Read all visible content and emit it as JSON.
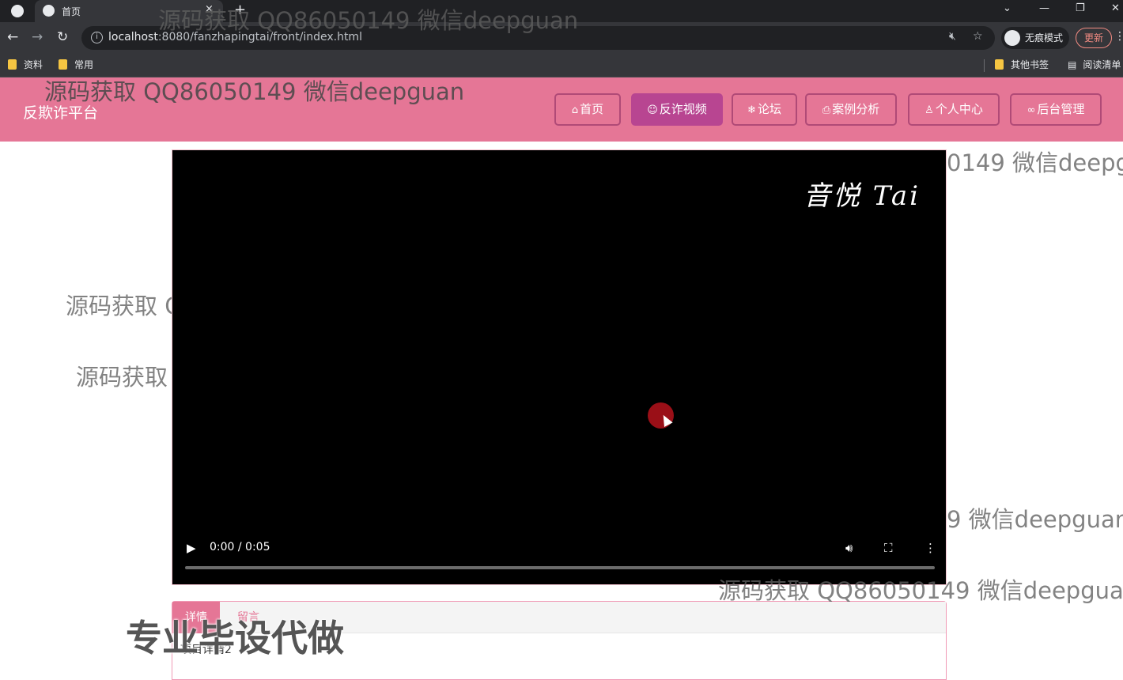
{
  "browser": {
    "tab_title": "首页",
    "tab_close": "×",
    "new_tab": "+",
    "url_host": "localhost",
    "url_rest": ":8080/fanzhapingtai/front/index.html",
    "incognito_label": "无痕模式",
    "update_label": "更新",
    "bookmarks_left": [
      "资料",
      "常用"
    ],
    "bookmarks_right": [
      "其他书签",
      "阅读清单"
    ]
  },
  "site": {
    "brand": "反欺诈平台",
    "nav": [
      {
        "label": "首页",
        "icon": "home-icon",
        "glyph": "⌂",
        "active": false
      },
      {
        "label": "反诈视频",
        "icon": "smile-icon",
        "glyph": "☺",
        "active": true
      },
      {
        "label": "论坛",
        "icon": "snowflake-icon",
        "glyph": "❄",
        "active": false
      },
      {
        "label": "案例分析",
        "icon": "printer-icon",
        "glyph": "⎙",
        "active": false
      },
      {
        "label": "个人中心",
        "icon": "user-icon",
        "glyph": "♙",
        "active": false
      },
      {
        "label": "后台管理",
        "icon": "link-icon",
        "glyph": "∞",
        "active": false
      }
    ],
    "accent_color": "#e57696",
    "active_nav_color": "#b84591"
  },
  "video": {
    "logo_text": "音悦 Tai",
    "time": "0:00 / 0:05",
    "progress": 0
  },
  "details_tabs": {
    "tabs": [
      "详情",
      "留言"
    ],
    "active_tab": "详情",
    "body_text": "项目详情2"
  },
  "watermarks": {
    "text": "源码获取 QQ86050149 微信deepguan",
    "partial_short": "源码获取",
    "partial_c": "源码获取 C",
    "right_a": "0149 微信deepg",
    "right_b": "9 微信deepguan",
    "right_c": "源码获取 QQ86050149 微信deepgua",
    "bold_banner": "专业毕设代做"
  }
}
